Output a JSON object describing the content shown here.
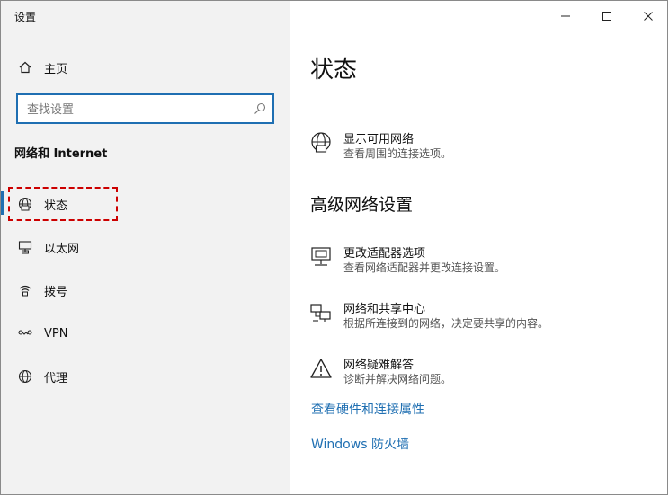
{
  "window": {
    "title": "设置"
  },
  "nav": {
    "home": "主页",
    "search_placeholder": "查找设置",
    "section": "网络和 Internet",
    "items": [
      {
        "label": "状态",
        "icon": "globe-icon",
        "active": true
      },
      {
        "label": "以太网",
        "icon": "ethernet-icon"
      },
      {
        "label": "拨号",
        "icon": "dialup-icon"
      },
      {
        "label": "VPN",
        "icon": "vpn-icon"
      },
      {
        "label": "代理",
        "icon": "proxy-globe-icon"
      }
    ]
  },
  "main": {
    "title": "状态",
    "available": {
      "title": "显示可用网络",
      "desc": "查看周围的连接选项。"
    },
    "advanced_title": "高级网络设置",
    "advanced": [
      {
        "title": "更改适配器选项",
        "desc": "查看网络适配器并更改连接设置。",
        "icon": "adapter-icon"
      },
      {
        "title": "网络和共享中心",
        "desc": "根据所连接到的网络，决定要共享的内容。",
        "icon": "sharing-icon"
      },
      {
        "title": "网络疑难解答",
        "desc": "诊断并解决网络问题。",
        "icon": "warning-icon"
      }
    ],
    "links": [
      "查看硬件和连接属性",
      "Windows 防火墙"
    ]
  },
  "colors": {
    "accent": "#1f6fb2",
    "highlight": "#cc0000",
    "nav_bg": "#f2f2f2"
  }
}
